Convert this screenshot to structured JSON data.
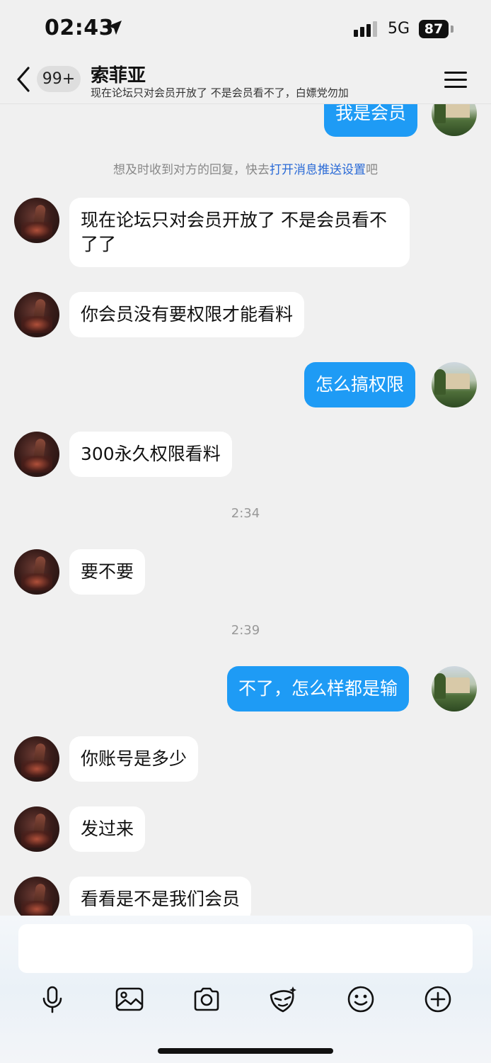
{
  "status_bar": {
    "time": "02:43",
    "network": "5G",
    "battery": "87"
  },
  "header": {
    "unread_badge": "99+",
    "contact_name": "索菲亚",
    "subtitle": "现在论坛只对会员开放了  不是会员看不了，白嫖党勿加"
  },
  "notice": {
    "prefix": "想及时收到对方的回复，快去",
    "link": "打开消息推送设置",
    "suffix": "吧"
  },
  "messages": [
    {
      "side": "right",
      "text": "我是会员"
    },
    {
      "side": "left",
      "text": "现在论坛只对会员开放了  不是会员看不了了"
    },
    {
      "side": "left",
      "text": "你会员没有要权限才能看料"
    },
    {
      "side": "right",
      "text": "怎么搞权限"
    },
    {
      "side": "left",
      "text": "300永久权限看料"
    },
    {
      "side": "left",
      "text": "要不要"
    },
    {
      "side": "right",
      "text": "不了，怎么样都是输"
    },
    {
      "side": "left",
      "text": "你账号是多少"
    },
    {
      "side": "left",
      "text": "发过来"
    },
    {
      "side": "left",
      "text": "看看是不是我们会员"
    }
  ],
  "timestamps": [
    "2:34",
    "2:39"
  ],
  "toolbar": {
    "icons": [
      "microphone-icon",
      "image-icon",
      "camera-icon",
      "mask-sticker-icon",
      "emoji-icon",
      "plus-icon"
    ]
  },
  "colors": {
    "outgoing_bubble": "#1e9bf5",
    "incoming_bubble": "#ffffff",
    "link": "#2a6ad6",
    "background": "#f0f0f0"
  }
}
